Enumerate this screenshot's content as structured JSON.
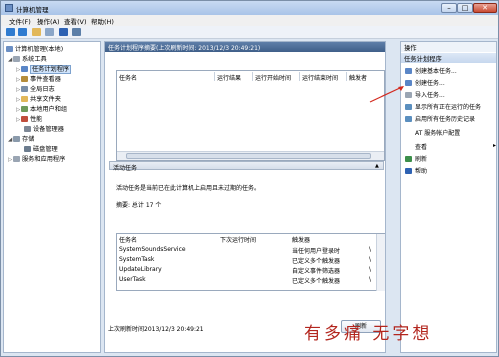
{
  "window": {
    "title": "计算机管理",
    "min": "–",
    "max": "□",
    "close": "✕"
  },
  "menu": [
    "文件(F)",
    "操作(A)",
    "查看(V)",
    "帮助(H)"
  ],
  "tree": {
    "root": "计算机管理(本地)",
    "system_tools": "系统工具",
    "task_scheduler": "任务计划程序",
    "event_viewer": "事件查看器",
    "task_library": "全局日志",
    "shared_folders": "共享文件夹",
    "local_users": "本地用户和组",
    "performance": "性能",
    "device_manager": "设备管理器",
    "storage": "存储",
    "disk_mgmt": "磁盘管理",
    "services": "服务和应用程序"
  },
  "center": {
    "header": "任务计划程序摘要(上次刷新时间: 2013/12/3 20:49:21)",
    "grid1_cols": [
      "任务名",
      "运行结果",
      "运行开始时间",
      "运行结束时间",
      "触发者"
    ],
    "section2": "活动任务",
    "description": "活动任务是当前已在此计算机上启用且未过期的任务。",
    "summary": "摘要: 总计 17 个",
    "grid2_cols": [
      "任务名",
      "下次运行时间",
      "触发器"
    ],
    "rows": [
      {
        "name": "SystemSoundsService",
        "next": "",
        "trigger": "当任何用户登录时",
        "loc": "\\"
      },
      {
        "name": "SystemTask",
        "next": "",
        "trigger": "已定义多个触发器",
        "loc": "\\"
      },
      {
        "name": "UpdateLibrary",
        "next": "",
        "trigger": "自定义事件筛选器",
        "loc": "\\"
      },
      {
        "name": "UserTask",
        "next": "",
        "trigger": "已定义多个触发器",
        "loc": "\\"
      }
    ],
    "last_refresh": "上次刷新时间2013/12/3 20:49:21",
    "refresh_button": "刷新"
  },
  "actions": {
    "header": "操作",
    "subheader": "任务计划程序",
    "items": [
      "创建基本任务...",
      "创建任务...",
      "导入任务...",
      "显示所有正在运行的任务",
      "启用所有任务历史记录",
      "AT 服务帐户配置",
      "查看",
      "刷新",
      "帮助"
    ]
  },
  "watermark": "有多痛 无字想",
  "colors": {
    "accent": "#4a6a94",
    "watermark": "#b3261e",
    "selection": "#cfe3fb"
  }
}
